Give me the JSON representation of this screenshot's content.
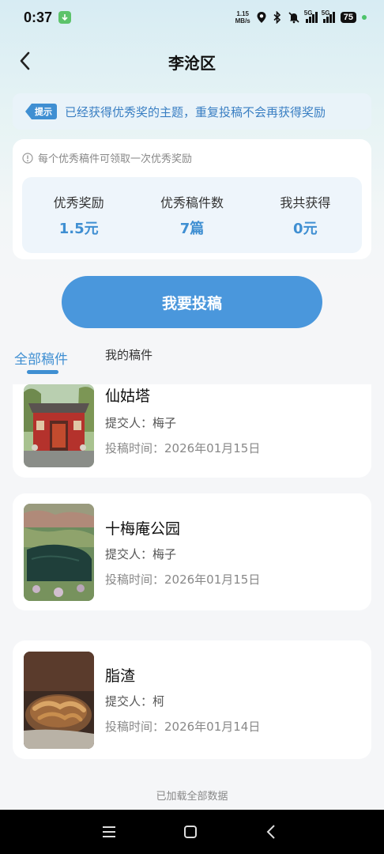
{
  "status_bar": {
    "time": "0:37",
    "net_speed_value": "1.15",
    "net_speed_unit": "MB/s",
    "signal_1_label": "5G",
    "signal_2_label": "5G",
    "battery": "75"
  },
  "header": {
    "title": "李沧区"
  },
  "tip": {
    "tag": "提示",
    "text": "已经获得优秀奖的主题，重复投稿不会再获得奖励"
  },
  "reward": {
    "note": "每个优秀稿件可领取一次优秀奖励",
    "stats": [
      {
        "label": "优秀奖励",
        "value": "1.5元"
      },
      {
        "label": "优秀稿件数",
        "value": "7篇"
      },
      {
        "label": "我共获得",
        "value": "0元"
      }
    ]
  },
  "submit_button": "我要投稿",
  "tabs": [
    {
      "label": "全部稿件",
      "active": true
    },
    {
      "label": "我的稿件",
      "active": false
    }
  ],
  "items": [
    {
      "title": "仙姑塔",
      "submitter": "提交人：梅子",
      "time": "投稿时间：2026年01月15日",
      "thumb_icon": "temple-gate-photo"
    },
    {
      "title": "十梅庵公园",
      "submitter": "提交人：梅子",
      "time": "投稿时间：2026年01月15日",
      "thumb_icon": "lake-park-photo"
    },
    {
      "title": "脂渣",
      "submitter": "提交人：柯",
      "time": "投稿时间：2026年01月14日",
      "thumb_icon": "fried-pork-photo"
    }
  ],
  "footer": "已加载全部数据",
  "colors": {
    "accent": "#3f8fd2",
    "button": "#4a97dc",
    "tip_bg": "#e9f3f9",
    "stats_bg": "#eef5fb"
  }
}
